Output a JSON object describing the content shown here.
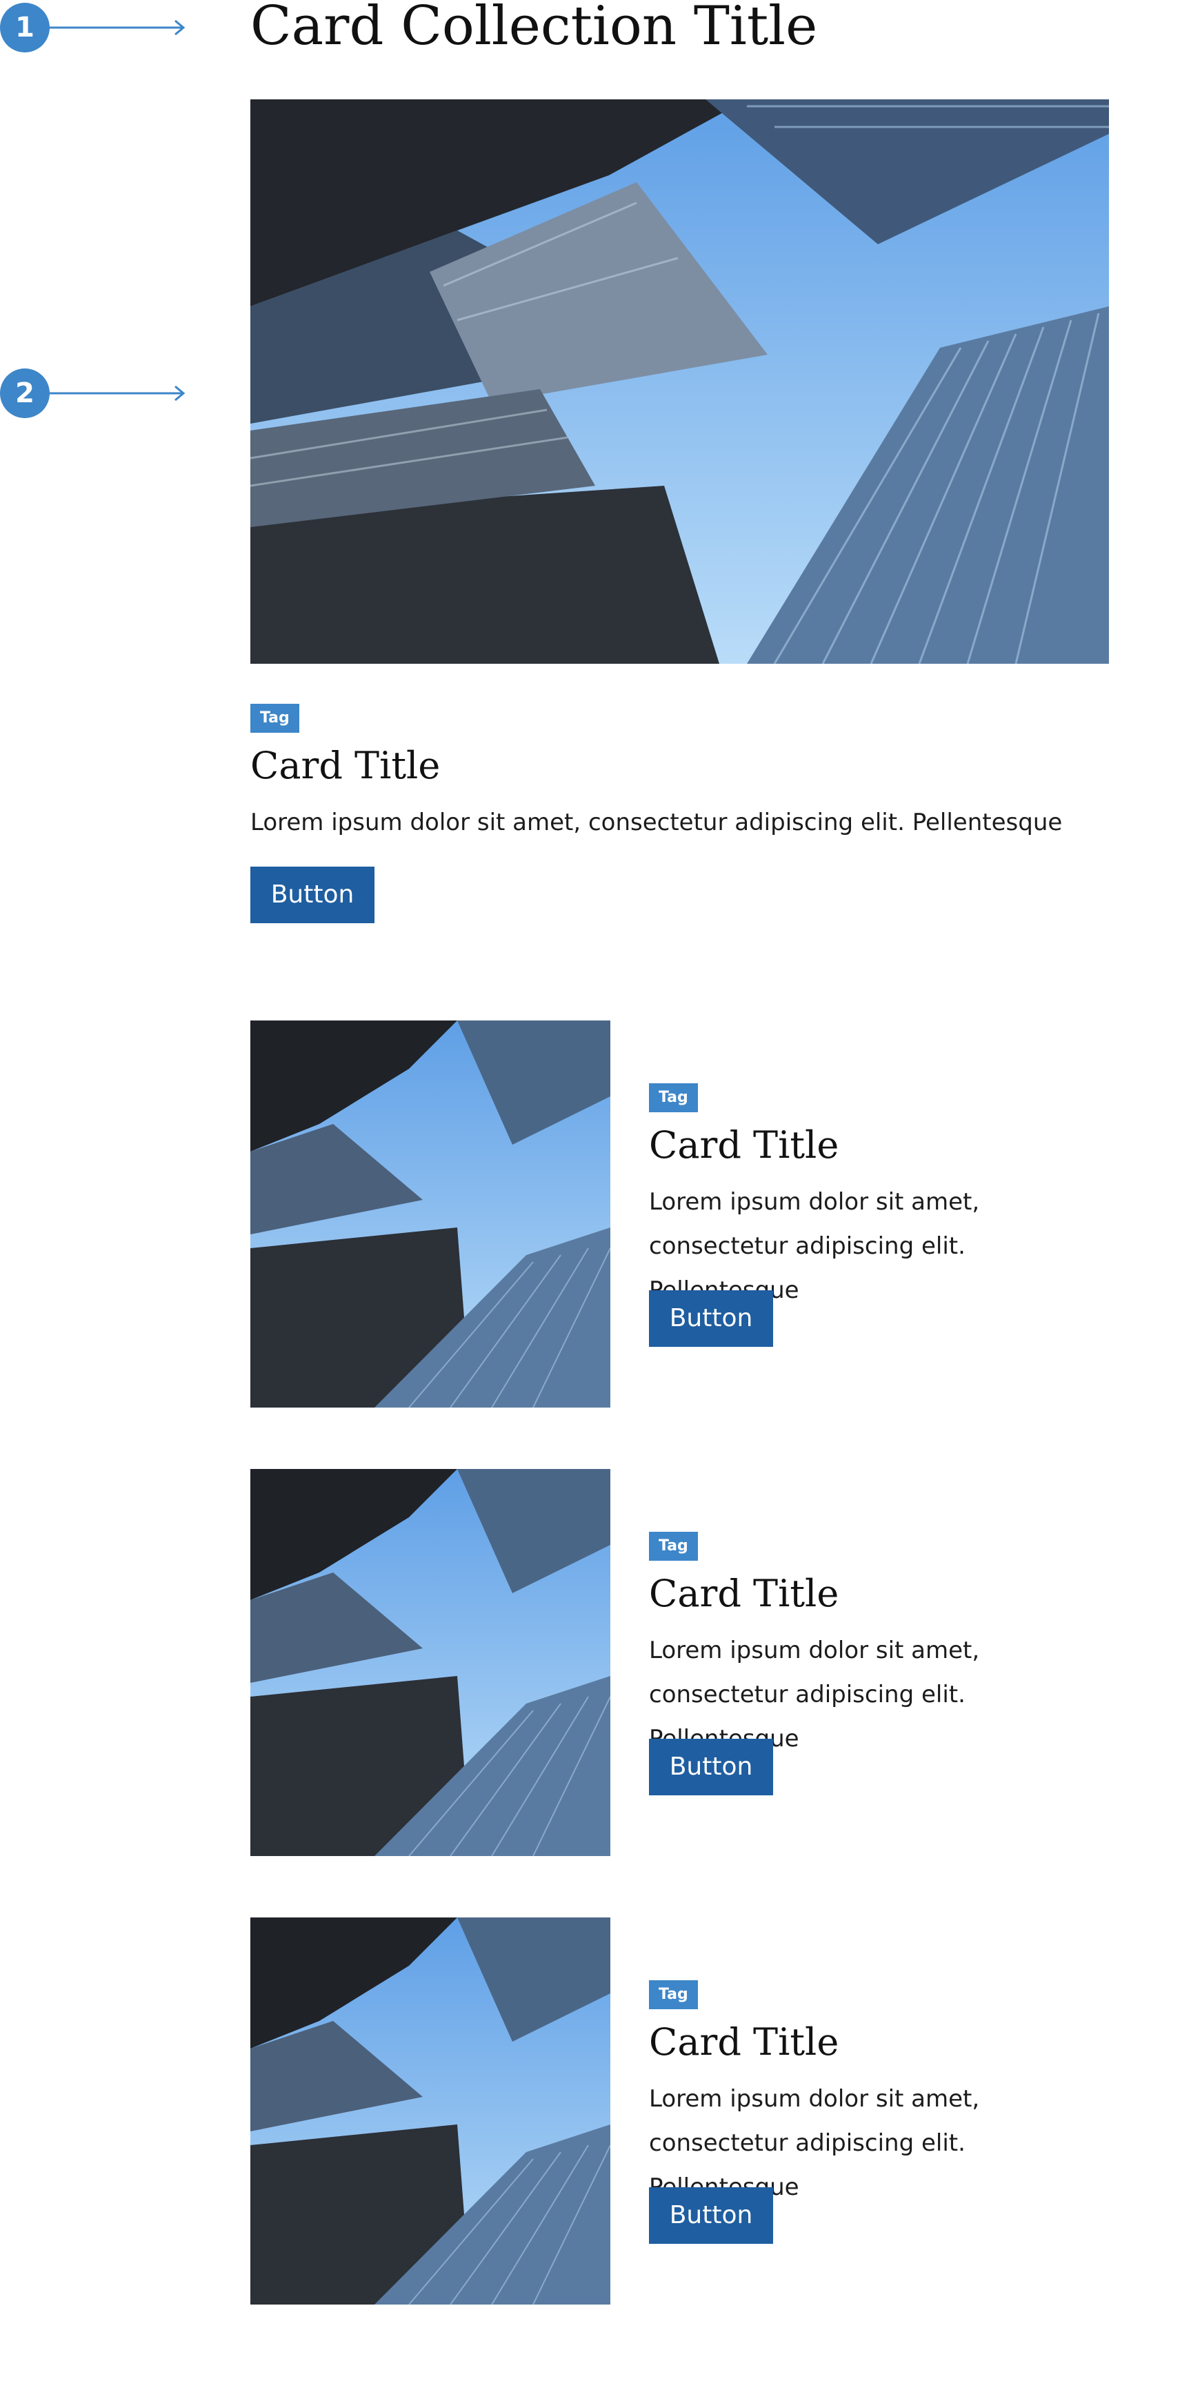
{
  "annotations": [
    "1",
    "2"
  ],
  "collection": {
    "title": "Card Collection Title"
  },
  "colors": {
    "accent": "#3d86c9",
    "button": "#1f5ea0",
    "sky": "#8ebff0"
  },
  "cards": [
    {
      "tag": "Tag",
      "title": "Card Title",
      "body": "Lorem ipsum dolor sit amet, consectetur adipiscing elit. Pellentesque",
      "button": "Button"
    },
    {
      "tag": "Tag",
      "title": "Card Title",
      "body": "Lorem ipsum dolor sit amet, consectetur adipiscing elit. Pellentesque",
      "button": "Button"
    },
    {
      "tag": "Tag",
      "title": "Card Title",
      "body": "Lorem ipsum dolor sit amet, consectetur adipiscing elit. Pellentesque",
      "button": "Button"
    },
    {
      "tag": "Tag",
      "title": "Card Title",
      "body": "Lorem ipsum dolor sit amet, consectetur adipiscing elit. Pellentesque",
      "button": "Button"
    }
  ]
}
